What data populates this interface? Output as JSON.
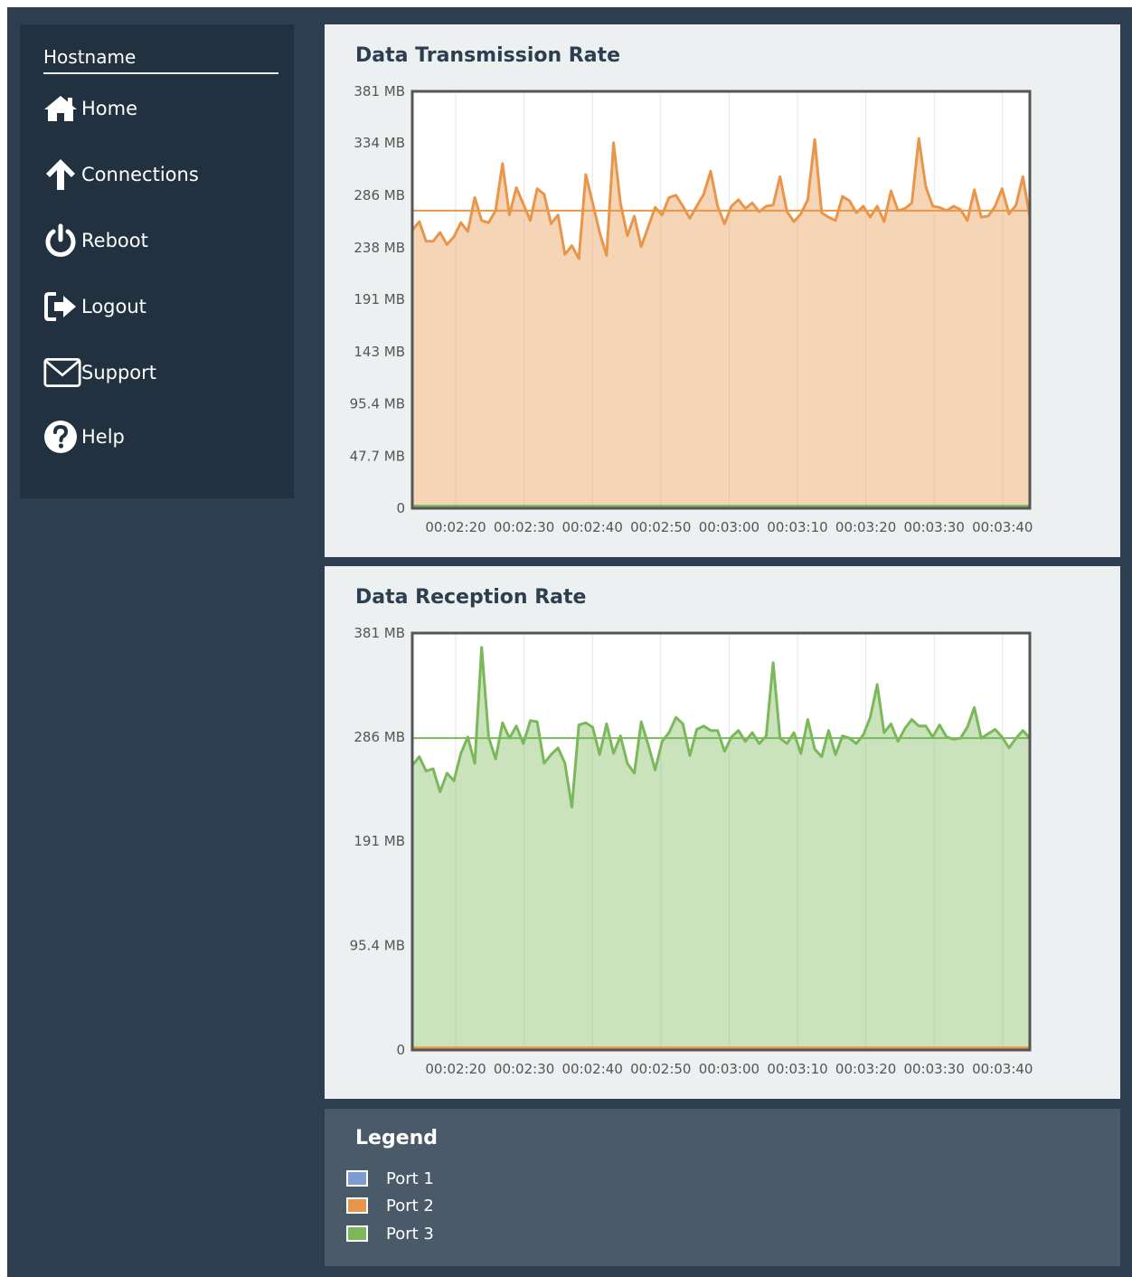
{
  "sidebar": {
    "hostname": "Hostname",
    "items": [
      {
        "label": "Home",
        "icon": "home-icon"
      },
      {
        "label": "Connections",
        "icon": "arrow-up-icon"
      },
      {
        "label": "Reboot",
        "icon": "power-icon"
      },
      {
        "label": "Logout",
        "icon": "logout-icon"
      },
      {
        "label": "Support",
        "icon": "envelope-icon"
      },
      {
        "label": "Help",
        "icon": "question-circle-icon"
      }
    ]
  },
  "colors": {
    "port1": "#7c9bd3",
    "port2": "#e8964a",
    "port3": "#7ab85a"
  },
  "legend": {
    "title": "Legend",
    "items": [
      "Port 1",
      "Port 2",
      "Port 3"
    ]
  },
  "chart_data": [
    {
      "type": "area",
      "title": "Data Transmission Rate",
      "xlabel": "",
      "ylabel": "",
      "ylim": [
        0,
        381
      ],
      "y_ticks": [
        0,
        47.7,
        95.4,
        143,
        191,
        238,
        286,
        334,
        381
      ],
      "y_tick_labels": [
        "0",
        "47.7 MB",
        "95.4 MB",
        "143 MB",
        "191 MB",
        "238 MB",
        "286 MB",
        "334 MB",
        "381 MB"
      ],
      "x_tick_labels": [
        "00:02:20",
        "00:02:30",
        "00:02:40",
        "00:02:50",
        "00:03:00",
        "00:03:10",
        "00:03:20",
        "00:03:30",
        "00:03:40"
      ],
      "reference_line": 272,
      "grid": true,
      "series": [
        {
          "name": "Port 2",
          "color": "#e8964a",
          "values": [
            254,
            262,
            244,
            244,
            252,
            241,
            248,
            261,
            253,
            284,
            263,
            261,
            272,
            315,
            268,
            293,
            278,
            263,
            292,
            287,
            260,
            268,
            232,
            240,
            228,
            305,
            279,
            252,
            231,
            334,
            279,
            249,
            267,
            239,
            257,
            275,
            268,
            284,
            286,
            276,
            265,
            276,
            287,
            308,
            276,
            260,
            276,
            282,
            274,
            279,
            271,
            276,
            277,
            303,
            271,
            262,
            269,
            282,
            337,
            270,
            266,
            263,
            285,
            281,
            270,
            276,
            266,
            276,
            262,
            290,
            272,
            274,
            279,
            338,
            294,
            276,
            275,
            272,
            276,
            273,
            263,
            291,
            266,
            267,
            276,
            292,
            269,
            277,
            303,
            266
          ]
        },
        {
          "name": "Port 3",
          "color": "#7ab85a",
          "values": [
            2,
            2,
            2,
            2,
            2,
            2,
            2,
            2,
            2,
            2,
            2,
            2,
            2,
            2,
            2,
            2,
            2,
            2,
            2,
            2,
            2,
            2,
            2,
            2,
            2,
            2,
            2,
            2,
            2,
            2,
            2,
            2,
            2,
            2,
            2,
            2,
            2,
            2,
            2,
            2,
            2,
            2,
            2,
            2,
            2,
            2,
            2,
            2,
            2,
            2,
            2,
            2,
            2,
            2,
            2,
            2,
            2,
            2,
            2,
            2,
            2,
            2,
            2,
            2,
            2,
            2,
            2,
            2,
            2,
            2,
            2,
            2,
            2,
            2,
            2,
            2,
            2,
            2,
            2,
            2,
            2,
            2,
            2,
            2,
            2,
            2,
            2,
            2,
            2,
            2
          ]
        }
      ]
    },
    {
      "type": "area",
      "title": "Data Reception Rate",
      "xlabel": "",
      "ylabel": "",
      "ylim": [
        0,
        381
      ],
      "y_ticks": [
        0,
        95.4,
        191,
        286,
        381
      ],
      "y_tick_labels": [
        "0",
        "95.4 MB",
        "191 MB",
        "286 MB",
        "381 MB"
      ],
      "x_tick_labels": [
        "00:02:20",
        "00:02:30",
        "00:02:40",
        "00:02:50",
        "00:03:00",
        "00:03:10",
        "00:03:20",
        "00:03:30",
        "00:03:40"
      ],
      "reference_line": 285,
      "grid": true,
      "series": [
        {
          "name": "Port 3",
          "color": "#7ab85a",
          "values": [
            260,
            268,
            255,
            257,
            236,
            253,
            246,
            271,
            286,
            262,
            368,
            286,
            266,
            299,
            285,
            296,
            280,
            301,
            300,
            262,
            270,
            276,
            262,
            222,
            297,
            299,
            295,
            270,
            298,
            271,
            287,
            262,
            253,
            300,
            279,
            256,
            282,
            290,
            304,
            298,
            269,
            293,
            296,
            292,
            292,
            273,
            286,
            292,
            282,
            290,
            280,
            287,
            354,
            285,
            280,
            290,
            271,
            302,
            275,
            268,
            292,
            270,
            287,
            285,
            280,
            288,
            304,
            334,
            290,
            298,
            282,
            294,
            302,
            296,
            296,
            286,
            297,
            286,
            284,
            285,
            295,
            313,
            285,
            289,
            293,
            286,
            276,
            285,
            292,
            285
          ]
        },
        {
          "name": "Port 2",
          "color": "#e8964a",
          "values": [
            2,
            2,
            2,
            2,
            2,
            2,
            2,
            2,
            2,
            2,
            2,
            2,
            2,
            2,
            2,
            2,
            2,
            2,
            2,
            2,
            2,
            2,
            2,
            2,
            2,
            2,
            2,
            2,
            2,
            2,
            2,
            2,
            2,
            2,
            2,
            2,
            2,
            2,
            2,
            2,
            2,
            2,
            2,
            2,
            2,
            2,
            2,
            2,
            2,
            2,
            2,
            2,
            2,
            2,
            2,
            2,
            2,
            2,
            2,
            2,
            2,
            2,
            2,
            2,
            2,
            2,
            2,
            2,
            2,
            2,
            2,
            2,
            2,
            2,
            2,
            2,
            2,
            2,
            2,
            2,
            2,
            2,
            2,
            2,
            2,
            2,
            2,
            2,
            2,
            2
          ]
        }
      ]
    }
  ]
}
